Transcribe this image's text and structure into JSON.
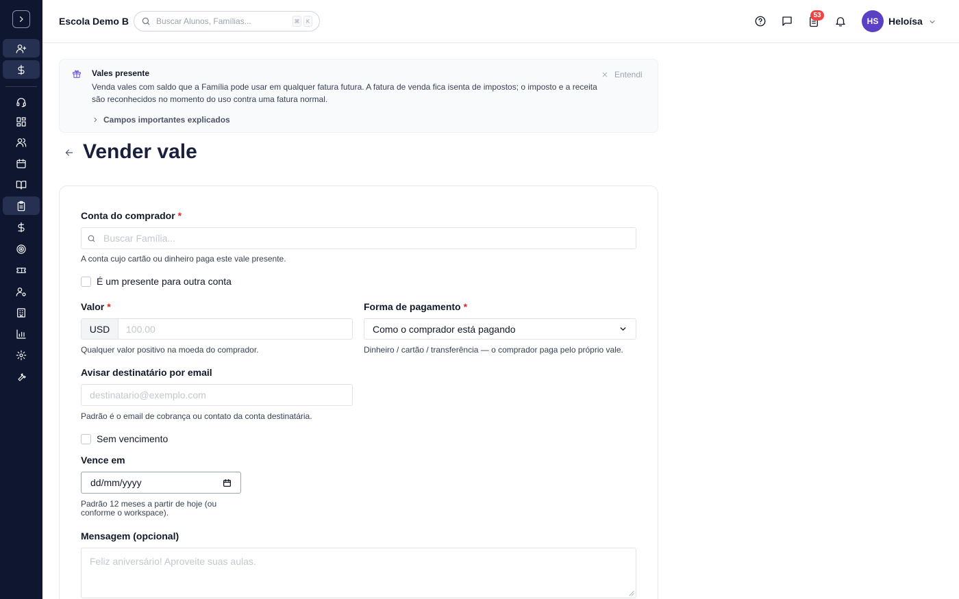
{
  "sidebar": {
    "toggle_icon": "chevron-right-icon",
    "items": [
      {
        "name": "add-user",
        "icon": "user-plus-icon"
      },
      {
        "name": "billing",
        "icon": "dollar-icon"
      },
      {
        "name": "support",
        "icon": "headset-icon"
      },
      {
        "name": "dashboard",
        "icon": "grid-icon"
      },
      {
        "name": "people",
        "icon": "users-icon"
      },
      {
        "name": "calendar",
        "icon": "calendar-icon"
      },
      {
        "name": "courses",
        "icon": "book-icon"
      },
      {
        "name": "invoices",
        "icon": "clipboard-icon",
        "active": true
      },
      {
        "name": "payments",
        "icon": "dollar-icon"
      },
      {
        "name": "goals",
        "icon": "target-icon"
      },
      {
        "name": "vouchers",
        "icon": "ticket-icon"
      },
      {
        "name": "user-settings",
        "icon": "user-gear-icon"
      },
      {
        "name": "organization",
        "icon": "building-icon"
      },
      {
        "name": "reports",
        "icon": "bar-chart-icon"
      },
      {
        "name": "settings",
        "icon": "gear-icon"
      },
      {
        "name": "tools",
        "icon": "wrench-icon"
      }
    ]
  },
  "header": {
    "school_name": "Escola Demo B",
    "search_placeholder": "Buscar Alunos, Famílias...",
    "kbd_1": "⌘",
    "kbd_2": "K",
    "tasks_badge": "53",
    "user_initials": "HS",
    "user_name": "Heloísa"
  },
  "banner": {
    "title": "Vales presente",
    "text": "Venda vales com saldo que a Família pode usar em qualquer fatura futura. A fatura de venda fica isenta de impostos; o imposto e a receita são reconhecidos no momento do uso contra uma fatura normal.",
    "link": "Campos importantes explicados",
    "dismiss": "Entendi"
  },
  "page": {
    "title": "Vender vale"
  },
  "form": {
    "buyer_label": "Conta do comprador",
    "required_mark": "*",
    "buyer_placeholder": "Buscar Família...",
    "buyer_help": "A conta cujo cartão ou dinheiro paga este vale presente.",
    "gift_checkbox": "É um presente para outra conta",
    "value_label": "Valor",
    "currency": "USD",
    "value_placeholder": "100.00",
    "value_help": "Qualquer valor positivo na moeda do comprador.",
    "payment_label": "Forma de pagamento",
    "payment_selected": "Como o comprador está pagando",
    "payment_help": "Dinheiro / cartão / transferência — o comprador paga pelo próprio vale.",
    "notify_label": "Avisar destinatário por email",
    "notify_placeholder": "destinatario@exemplo.com",
    "notify_help": "Padrão é o email de cobrança ou contato da conta destinatária.",
    "no_expiry_checkbox": "Sem vencimento",
    "expires_label": "Vence em",
    "date_placeholder": "dd/mm/yyyy",
    "expires_help_1": "Padrão 12 meses a partir de hoje (ou",
    "expires_help_2": "conforme o workspace).",
    "message_label": "Mensagem (opcional)",
    "message_placeholder": "Feliz aniversário! Aproveite suas aulas."
  }
}
